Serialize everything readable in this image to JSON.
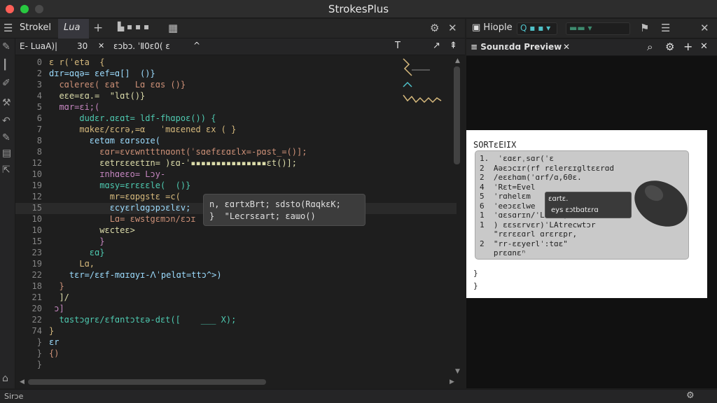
{
  "window": {
    "title": "StrokesPlus"
  },
  "toolbar": {
    "menu_label": "☰",
    "strokes_label": "Strokel",
    "lua_label": "Lua",
    "add_label": "+",
    "doc_label": "▙ ▪ ▪ ▪",
    "grid_label": "▦",
    "settings_label": "⚙",
    "close_label": "✕"
  },
  "right_toolbar": {
    "folder_label": "▣ Hiople",
    "search_label": "Q ▪ ▪ ▾",
    "select_label": "▬▬ ▾",
    "pin_label": "⚑",
    "list_label": "☰",
    "close_label": "✕"
  },
  "editor": {
    "tab_label": "E- LuaA)|",
    "tab_num": "30",
    "tab_close": "✕",
    "tab_extra": "ε",
    "tab_path": "ɛɔbɔ. ˈⅡ0ɛ0( ε",
    "tab_up": "^",
    "right_icons": [
      "T",
      "↗",
      "⇞"
    ],
    "lines": [
      {
        "ln": "0",
        "code": "ɛ r(ˈeta  {"
      },
      {
        "ln": "2",
        "code": "dɪr=ɑqə= ɛef=ɑ[]  ()}"
      },
      {
        "ln": "3",
        "code": "  cɑlereɛ( ɛat   Lɑ ɛɑs ()}"
      },
      {
        "ln": "4",
        "code": "  eɛe=ɛɑ.=  \"lɑt()}"
      },
      {
        "ln": "5",
        "code": "  mɑr=ɛi;("
      },
      {
        "ln": "6",
        "code": "      dudɛr.ɑɛɑt= ldf-fhɑpoɛ()) {"
      },
      {
        "ln": "7",
        "code": "      mɑkeɛ/ɛcrə,=α   ˈmɑɛened εx ( }"
      },
      {
        "ln": "8",
        "code": "        ɛetɑm ɛɑrsoɪe("
      },
      {
        "ln": "8",
        "code": "          ɛɑr=ɛvɛwntttnɑont(ˈsɑefɛɛɑɛlx=-pɑst_=()];"
      },
      {
        "ln": "12",
        "code": "          ɛetrɛɛeɛtɪn= )ɛɑ-ˈ▪▪▪▪▪▪▪▪▪▪▪▪▪▪▪ɛt()];"
      },
      {
        "ln": "10",
        "code": "          ɪnhɑeɛo= Lɔy-"
      },
      {
        "ln": "19",
        "code": "          mɑsy=ɛrɛɛɛle(  ()}"
      },
      {
        "ln": "12",
        "code": "            mr=ɛɑpgstɛ =c("
      },
      {
        "ln": "15",
        "code": "            ɛcyɛrlɑgɔpɔɛlɛv;"
      },
      {
        "ln": "10",
        "code": "            Lɑ= ɛwstgɛmɔn/ɛɔɪ"
      },
      {
        "ln": "10",
        "code": "          wɛcteɛ>"
      },
      {
        "ln": "15",
        "code": "          }"
      },
      {
        "ln": "23",
        "code": "        ɛɑ}"
      },
      {
        "ln": "19",
        "code": "      Lɑ,"
      },
      {
        "ln": "22",
        "code": "    tɛr=/ɛɛf-mɑɪɑyɪ-ᐱˈpelɑt=ttɔ^>)"
      },
      {
        "ln": "18",
        "code": "  }"
      },
      {
        "ln": "21",
        "code": "  ]/"
      },
      {
        "ln": "20",
        "code": " ɔ]"
      },
      {
        "ln": "22",
        "code": "  tɑstɔgrɛ/ɛfɑntɔtɛə-dɛt([    ___ X);"
      },
      {
        "ln": "74",
        "code": "}"
      },
      {
        "ln": "}",
        "code": "ɛr"
      },
      {
        "ln": "}",
        "code": "{)"
      },
      {
        "ln": "}",
        "code": ""
      }
    ],
    "tooltip_line1": "n, ɛɑrtxBrt; sdsto(RɑqkɛK;",
    "tooltip_line2": "}  \"Lecrsɛart; ɛaɯo()"
  },
  "preview": {
    "title": "≡ Sounɛdɑ Preview",
    "close_label": "✕",
    "icons": [
      "⌕",
      "⚙",
      "+",
      "✕"
    ],
    "heading": "SORTɛEⅠIX",
    "lines": [
      "1.  ˈɛɑɛrˌsɑr(ˈε",
      "2  Aəɛɔcɪr(rf rɛlerɛɪgltɛɛrɑd",
      "2  /eɛɛhɑm(ˈɑrf/ɑ,60ɛ.",
      "4  ˈRɛt=Evel",
      "5  ˈrɑhelɛm",
      "6  ˈeeɔɛɛlwe",
      "1  ˈɑɛsɑrɪn/ˈLlɑtɔ;",
      "1  ) ɛɛsɛrvɛr)ˈLAtrecwtɔr",
      "   \"rɛrɛɛɑrl ɑrɛrɛpr,",
      "2  \"rr-ɛɛyerlˈ:tɑɛ\"",
      "   prɛɑnɛⁿ"
    ],
    "closing": [
      "}",
      "}"
    ],
    "popup_line1": "ɛɑrtɛ.",
    "popup_line2": "eys ɛɔtbɑtɛrɑ"
  },
  "status": {
    "text": "Sirɔe",
    "icon": "⚙"
  }
}
